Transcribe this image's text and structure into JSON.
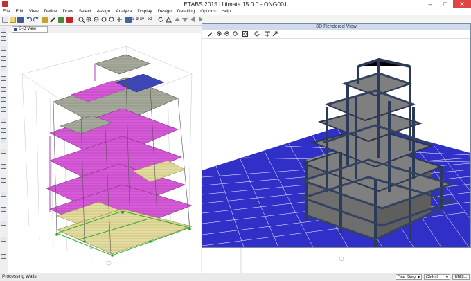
{
  "window": {
    "title": "ETABS 2015 Ultimate 15.0.0 - ONG001"
  },
  "menu": [
    "File",
    "Edit",
    "View",
    "Define",
    "Draw",
    "Select",
    "Assign",
    "Analyze",
    "Display",
    "Design",
    "Detailing",
    "Options",
    "Help"
  ],
  "toolbar": {
    "view_3d_label": "3-d",
    "plan_label": "xy",
    "elev_label": "xz"
  },
  "views": {
    "left_tab": "3-D View",
    "right_title": "3D Rendered View"
  },
  "status": {
    "message": "Processing Walls",
    "story_select": "One Story",
    "coord_select": "Global",
    "units_button": "Units..."
  },
  "icons": {
    "side": [
      "pointer-icon",
      "reshape-icon",
      "line-icon",
      "beam-icon",
      "column-icon",
      "brace-icon",
      "wall-icon",
      "floor-icon",
      "area-icon",
      "opening-icon",
      "rectangle-icon",
      "polygon-icon",
      "grid-icon",
      "dimension-icon",
      "snap-icon",
      "support-icon",
      "link-icon",
      "tendon-icon",
      "point-icon",
      "section-cut-icon"
    ],
    "render": [
      "pencil-icon",
      "zoom-in-icon",
      "zoom-out-icon",
      "zoom-window-icon",
      "zoom-fit-icon",
      "rotate-icon",
      "perspective-icon",
      "options-icon"
    ]
  },
  "colors": {
    "accent": "#2b4e86",
    "slab_magenta": "#d055d8",
    "slab_gray": "#9aa29a",
    "frame_dark": "#2f3b52",
    "ground_blue": "#2323c8"
  }
}
